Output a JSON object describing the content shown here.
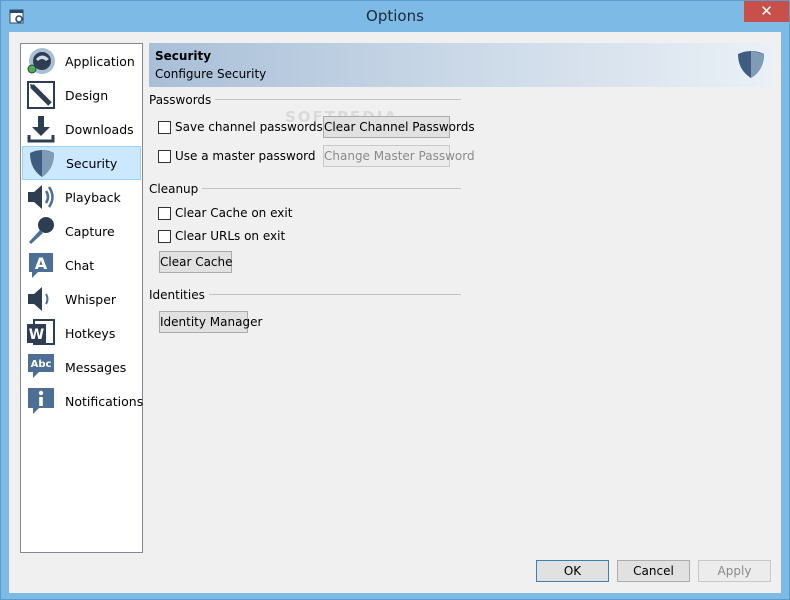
{
  "window": {
    "title": "Options",
    "close_glyph": "✕"
  },
  "sidebar": {
    "items": [
      {
        "label": "Application",
        "icon": "teamspeak-logo-icon"
      },
      {
        "label": "Design",
        "icon": "pen-icon"
      },
      {
        "label": "Downloads",
        "icon": "download-icon"
      },
      {
        "label": "Security",
        "icon": "shield-icon",
        "selected": true
      },
      {
        "label": "Playback",
        "icon": "speaker-icon"
      },
      {
        "label": "Capture",
        "icon": "microphone-icon"
      },
      {
        "label": "Chat",
        "icon": "chat-icon"
      },
      {
        "label": "Whisper",
        "icon": "whisper-icon"
      },
      {
        "label": "Hotkeys",
        "icon": "hotkeys-icon"
      },
      {
        "label": "Messages",
        "icon": "messages-icon"
      },
      {
        "label": "Notifications",
        "icon": "info-icon"
      }
    ]
  },
  "header": {
    "title": "Security",
    "subtitle": "Configure Security",
    "icon": "shield-icon"
  },
  "passwords": {
    "label": "Passwords",
    "save_channel": "Save channel passwords",
    "use_master": "Use a master password",
    "clear_channel_btn": "Clear Channel Passwords",
    "change_master_btn": "Change Master Password"
  },
  "cleanup": {
    "label": "Cleanup",
    "clear_cache_exit": "Clear Cache on exit",
    "clear_urls_exit": "Clear URLs on exit",
    "clear_cache_btn": "Clear Cache"
  },
  "identities": {
    "label": "Identities",
    "identity_manager_btn": "Identity Manager"
  },
  "footer": {
    "ok": "OK",
    "cancel": "Cancel",
    "apply": "Apply"
  },
  "watermark": "SOFTPEDIA",
  "colors": {
    "titlebar": "#7dbbe6",
    "selected": "#cce8ff",
    "close": "#c7504a",
    "icon_blue": "#4d6f95"
  }
}
